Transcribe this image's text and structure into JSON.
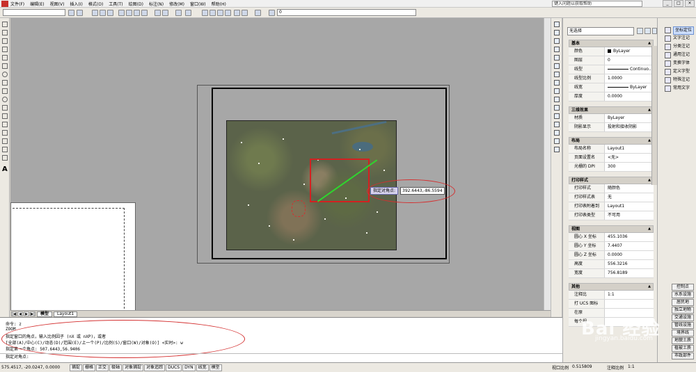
{
  "menubar": {
    "items": [
      "文件(F)",
      "编辑(E)",
      "视图(V)",
      "插入(I)",
      "格式(O)",
      "工具(T)",
      "绘图(D)",
      "标注(N)",
      "修改(M)",
      "窗口(W)",
      "帮助(H)"
    ],
    "help_placeholder": "键入问题以获取帮助"
  },
  "toolbar": {
    "layer_value": "0"
  },
  "canvas": {
    "tip_label": "指定对角点:",
    "tip_value": "392.6443,-86.5594",
    "tabs": [
      "模型",
      "Layout1"
    ]
  },
  "properties": {
    "selection": "无选择",
    "sections": [
      {
        "title": "基本",
        "rows": [
          {
            "key": "颜色",
            "value": "ByLayer",
            "swatch": true
          },
          {
            "key": "图层",
            "value": "0"
          },
          {
            "key": "线型",
            "value": "Continuo...",
            "line": true
          },
          {
            "key": "线型比例",
            "value": "1.0000"
          },
          {
            "key": "线宽",
            "value": "ByLayer",
            "line": true
          },
          {
            "key": "厚度",
            "value": "0.0000"
          }
        ]
      },
      {
        "title": "三维效果",
        "rows": [
          {
            "key": "材质",
            "value": "ByLayer"
          },
          {
            "key": "阴影显示",
            "value": "投射和接收阴影"
          }
        ]
      },
      {
        "title": "布局",
        "rows": [
          {
            "key": "布局名称",
            "value": "Layout1"
          },
          {
            "key": "页面设置名",
            "value": "<无>"
          },
          {
            "key": "光栅的 DPI",
            "value": "300"
          }
        ]
      },
      {
        "title": "打印样式",
        "rows": [
          {
            "key": "打印样式",
            "value": "随颜色"
          },
          {
            "key": "打印样式表",
            "value": "无"
          },
          {
            "key": "打印表附着到",
            "value": "Layout1"
          },
          {
            "key": "打印表类型",
            "value": "不可用"
          }
        ]
      },
      {
        "title": "视图",
        "rows": [
          {
            "key": "圆心 X 坐标",
            "value": "455.1036"
          },
          {
            "key": "圆心 Y 坐标",
            "value": "7.4407"
          },
          {
            "key": "圆心 Z 坐标",
            "value": "0.0000"
          },
          {
            "key": "高度",
            "value": "556.3216"
          },
          {
            "key": "宽度",
            "value": "756.8189"
          }
        ]
      },
      {
        "title": "其他",
        "rows": [
          {
            "key": "注释比",
            "value": "1:1"
          },
          {
            "key": "打 UCS 图标",
            "value": ""
          },
          {
            "key": "在原",
            "value": ""
          },
          {
            "key": "每个视",
            "value": ""
          }
        ]
      }
    ]
  },
  "right_panel": {
    "labels": [
      "坐标定位",
      "文字注记",
      "分类注记",
      "通用注记",
      "变换字体",
      "定义字型",
      "特殊注记",
      "常用文字"
    ],
    "buttons": [
      "控制点",
      "水系设施",
      "居民地",
      "独立地物",
      "交通设施",
      "管线设施",
      "境界线",
      "地貌土质",
      "植被土质",
      "市政部件"
    ]
  },
  "command": {
    "lines": [
      "命令: z",
      "ZOOM",
      "指定窗口的角点，输入比例因子 (nX 或 nXP)，或者",
      "[全部(A)/中心(C)/动态(D)/范围(E)/上一个(P)/比例(S)/窗口(W)/对象(O)] <实时>: w",
      "指定第一个角点: 507.6443,56.9406"
    ],
    "prompt": "指定对角点:"
  },
  "status": {
    "coords": "575.4517, -20.0247, 0.0000",
    "buttons": [
      "捕捉",
      "栅格",
      "正交",
      "极轴",
      "对象捕捉",
      "对象追踪",
      "DUCS",
      "DYN",
      "线宽",
      "模型"
    ],
    "viewport_scale_label": "视口比例",
    "viewport_scale_value": "0.515809",
    "annotation_scale_label": "注释比例",
    "annotation_scale_value": "1:1"
  },
  "watermark": {
    "text": "Bai 经验",
    "url": "jingyan.baidu.com"
  }
}
